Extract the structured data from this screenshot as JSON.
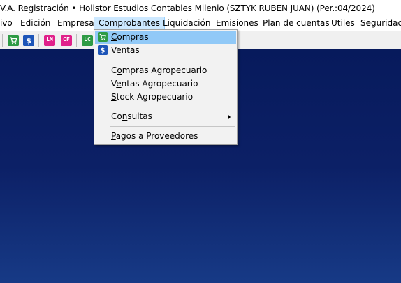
{
  "window": {
    "title": "V.A. Registración • Holistor Estudios Contables Milenio  (SZTYK RUBEN JUAN) (Per.:04/2024)"
  },
  "menubar": {
    "items": [
      "ivo",
      "Edición",
      "Empresa",
      "Comprobantes",
      "Liquidación",
      "Emisiones",
      "Plan de cuentas",
      "Utiles",
      "Seguridad"
    ]
  },
  "toolbar": {
    "buttons": [
      {
        "icon": "cart-icon",
        "color": "#2e9b45"
      },
      {
        "icon": "dollar-icon",
        "color": "#1d55b8"
      },
      {
        "icon": "lm-icon",
        "text": "LM",
        "color": "#e0218a"
      },
      {
        "icon": "cf-icon",
        "text": "CF",
        "color": "#e0218a"
      },
      {
        "icon": "lc-icon",
        "text": "LC",
        "color": "#2e9b45"
      }
    ]
  },
  "dropdown": {
    "items": [
      {
        "label_first": "C",
        "label_rest": "ompras",
        "icon": "cart-icon"
      },
      {
        "label_first": "V",
        "label_rest": "entas",
        "icon": "dollar-icon"
      },
      {
        "label_pre": "C",
        "label_ul": "o",
        "label_post": "mpras Agropecuario"
      },
      {
        "label_pre": "V",
        "label_ul": "e",
        "label_post": "ntas Agropecuario"
      },
      {
        "label_first": "S",
        "label_rest": "tock Agropecuario"
      },
      {
        "label_pre": "Co",
        "label_ul": "n",
        "label_post": "sultas"
      },
      {
        "label_first": "P",
        "label_rest": "agos a Proveedores"
      }
    ]
  },
  "colors": {
    "menu_highlight": "#91c9f7",
    "desktop_blue": "#0c2066"
  }
}
